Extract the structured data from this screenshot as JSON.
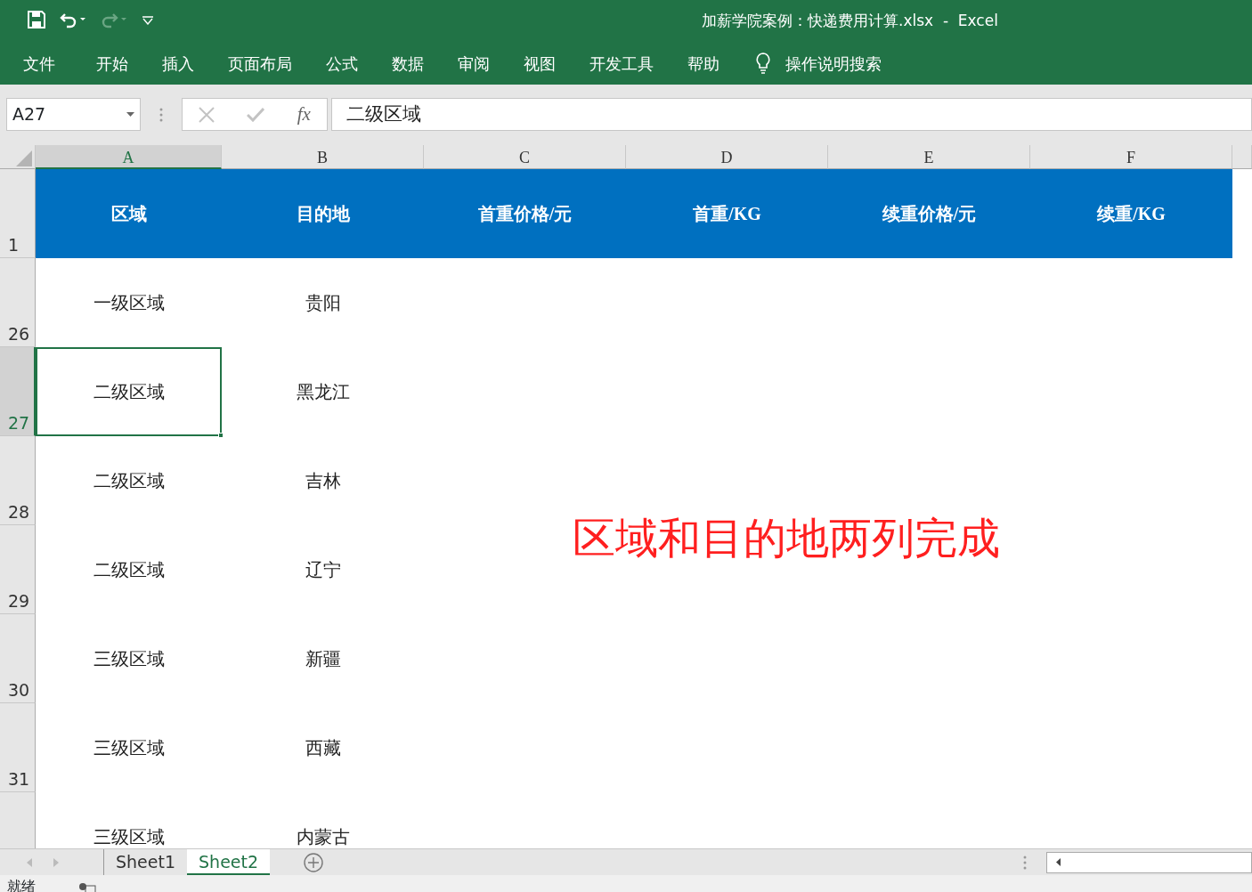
{
  "window": {
    "title": "加薪学院案例：快递费用计算.xlsx  -  Excel"
  },
  "ribbon_tabs": [
    {
      "label": "文件"
    },
    {
      "label": "开始"
    },
    {
      "label": "插入"
    },
    {
      "label": "页面布局"
    },
    {
      "label": "公式"
    },
    {
      "label": "数据"
    },
    {
      "label": "审阅"
    },
    {
      "label": "视图"
    },
    {
      "label": "开发工具"
    },
    {
      "label": "帮助"
    }
  ],
  "tell_me": {
    "placeholder": "操作说明搜索"
  },
  "formula_bar": {
    "name_box": "A27",
    "function_label": "fx",
    "formula": "二级区域"
  },
  "columns": [
    {
      "label": "A",
      "selected": true
    },
    {
      "label": "B",
      "selected": false
    },
    {
      "label": "C",
      "selected": false
    },
    {
      "label": "D",
      "selected": false
    },
    {
      "label": "E",
      "selected": false
    },
    {
      "label": "F",
      "selected": false
    }
  ],
  "header_row": {
    "number": "1",
    "cells": [
      "区域",
      "目的地",
      "首重价格/元",
      "首重/KG",
      "续重价格/元",
      "续重/KG"
    ]
  },
  "rows": [
    {
      "number": "26",
      "selected": false,
      "cells": [
        "一级区域",
        "贵阳"
      ]
    },
    {
      "number": "27",
      "selected": true,
      "cells": [
        "二级区域",
        "黑龙江"
      ]
    },
    {
      "number": "28",
      "selected": false,
      "cells": [
        "二级区域",
        "吉林"
      ]
    },
    {
      "number": "29",
      "selected": false,
      "cells": [
        "二级区域",
        "辽宁"
      ]
    },
    {
      "number": "30",
      "selected": false,
      "cells": [
        "三级区域",
        "新疆"
      ]
    },
    {
      "number": "31",
      "selected": false,
      "cells": [
        "三级区域",
        "西藏"
      ]
    },
    {
      "selected": false,
      "cells": [
        "三级区域",
        "内蒙古"
      ]
    }
  ],
  "annotation": "区域和目的地两列完成",
  "sheet_tabs": [
    {
      "label": "Sheet1",
      "selected": false
    },
    {
      "label": "Sheet2",
      "selected": true
    }
  ],
  "status_bar": {
    "text": "就绪"
  }
}
